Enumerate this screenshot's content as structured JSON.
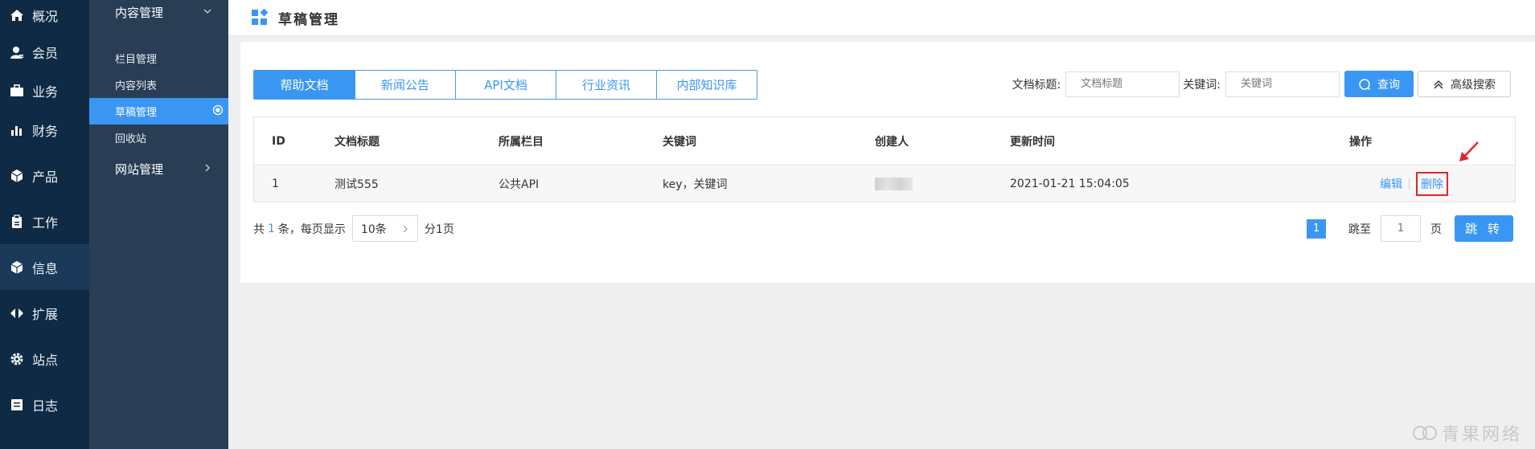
{
  "nav_primary": [
    {
      "label": "概况",
      "icon": "home-icon"
    },
    {
      "label": "会员",
      "icon": "user-icon"
    },
    {
      "label": "业务",
      "icon": "briefcase-icon"
    },
    {
      "label": "财务",
      "icon": "bar-chart-icon"
    },
    {
      "label": "产品",
      "icon": "product-icon"
    },
    {
      "label": "工作",
      "icon": "clipboard-icon"
    },
    {
      "label": "信息",
      "icon": "cube-icon"
    },
    {
      "label": "扩展",
      "icon": "expand-icon"
    },
    {
      "label": "站点",
      "icon": "gear-icon"
    },
    {
      "label": "日志",
      "icon": "log-icon"
    }
  ],
  "nav_secondary": {
    "group1": "内容管理",
    "items": [
      "栏目管理",
      "内容列表",
      "草稿管理",
      "回收站"
    ],
    "group2": "网站管理"
  },
  "header": {
    "title": "草稿管理"
  },
  "tabs": [
    "帮助文档",
    "新闻公告",
    "API文档",
    "行业资讯",
    "内部知识库"
  ],
  "search": {
    "title_label": "文档标题:",
    "title_placeholder": "文档标题",
    "keyword_label": "关键词:",
    "keyword_placeholder": "关键词",
    "query_label": "查询",
    "advanced_label": "高级搜索"
  },
  "table": {
    "columns": [
      "ID",
      "文档标题",
      "所属栏目",
      "关键词",
      "创建人",
      "更新时间",
      "操作"
    ],
    "rows": [
      {
        "id": "1",
        "title": "测试555",
        "column": "公共API",
        "keywords": "key，关键词",
        "creator": "",
        "updated": "2021-01-21 15:04:05",
        "edit": "编辑",
        "delete": "删除"
      }
    ]
  },
  "pagination": {
    "prefix": "共",
    "total": "1",
    "mid": "条，每页显示",
    "page_size": "10条",
    "pages": "分1页",
    "current": "1",
    "jump_to": "跳至",
    "jump_placeholder": "1",
    "page_unit": "页",
    "jump_button": "跳 转"
  },
  "watermark": "青果网络",
  "colors": {
    "accent": "#3a96f3",
    "nav_dark": "#0f2a44",
    "nav_secondary": "#293e55",
    "highlight": "#e0262b"
  }
}
